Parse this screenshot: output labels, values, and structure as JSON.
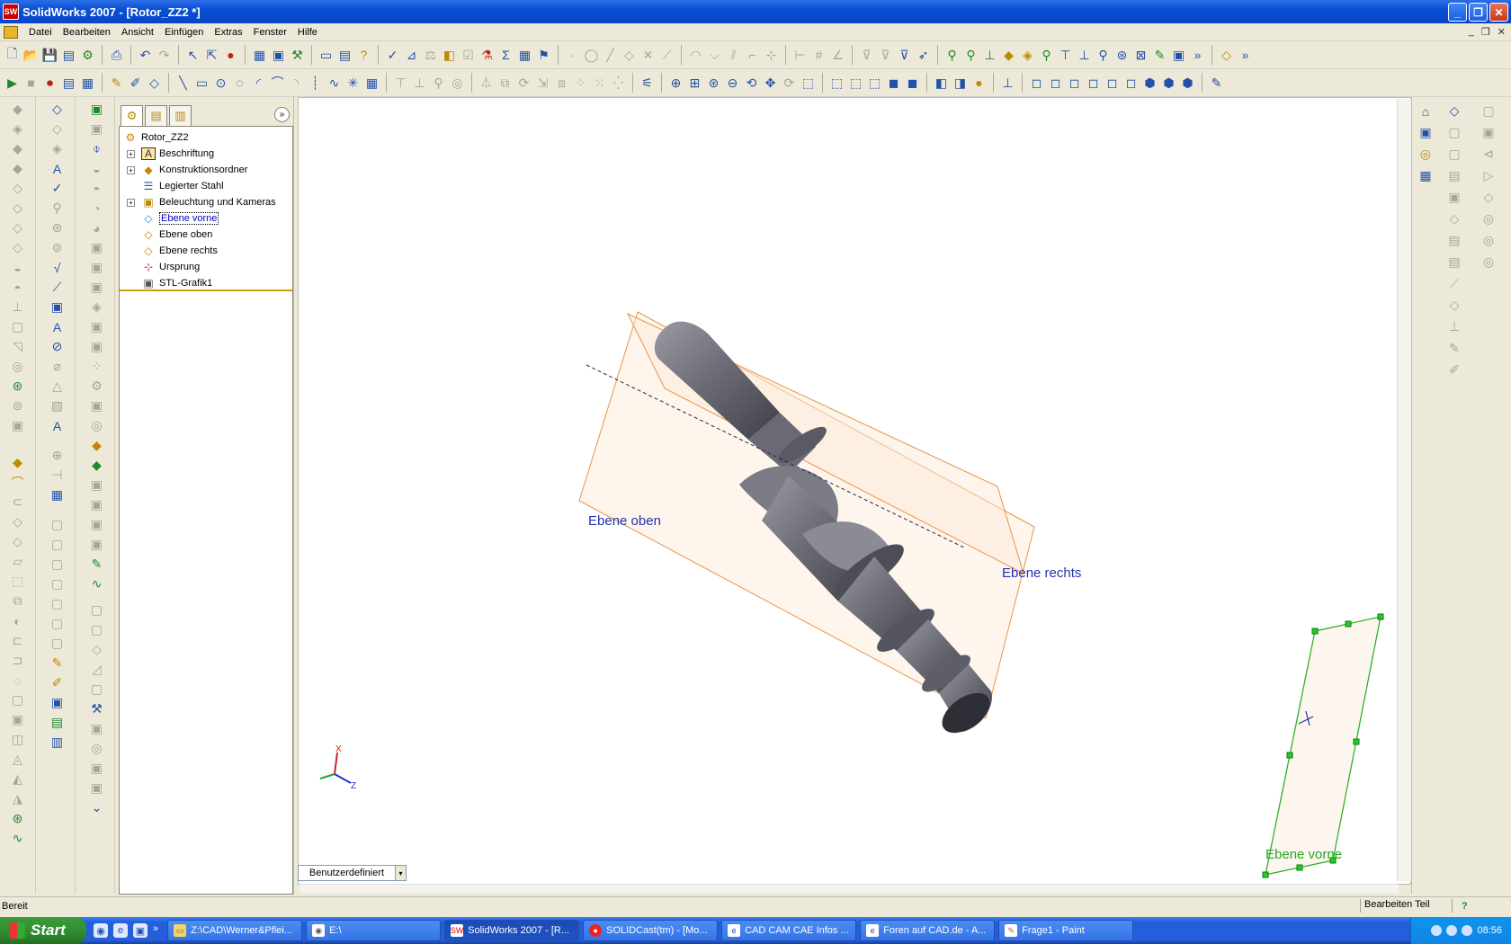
{
  "window": {
    "title": "SolidWorks 2007 - [Rotor_ZZ2 *]",
    "logo_text": "SW",
    "minimize": "_",
    "maximize": "❐",
    "close": "✕"
  },
  "menu": {
    "items": [
      "Datei",
      "Bearbeiten",
      "Ansicht",
      "Einfügen",
      "Extras",
      "Fenster",
      "Hilfe"
    ],
    "doc_controls": [
      "_",
      "❐",
      "✕"
    ]
  },
  "feature_manager": {
    "collapse": "»",
    "root": "Rotor_ZZ2",
    "items": [
      {
        "label": "Beschriftung",
        "icon": "annotations-icon",
        "expandable": true
      },
      {
        "label": "Konstruktionsordner",
        "icon": "design-folder-icon",
        "expandable": true
      },
      {
        "label": "Legierter Stahl",
        "icon": "material-icon",
        "expandable": false
      },
      {
        "label": "Beleuchtung und Kameras",
        "icon": "lights-cameras-icon",
        "expandable": true
      },
      {
        "label": "Ebene vorne",
        "icon": "plane-icon",
        "expandable": false,
        "selected": true
      },
      {
        "label": "Ebene oben",
        "icon": "plane-icon",
        "expandable": false
      },
      {
        "label": "Ebene rechts",
        "icon": "plane-icon",
        "expandable": false
      },
      {
        "label": "Ursprung",
        "icon": "origin-icon",
        "expandable": false
      },
      {
        "label": "STL-Grafik1",
        "icon": "stl-graphic-icon",
        "expandable": false
      }
    ],
    "plus": "+"
  },
  "viewport": {
    "labels": {
      "top_plane": "Ebene oben",
      "right_plane": "Ebene rechts",
      "front_plane": "Ebene vorne"
    },
    "triad": {
      "x": "X",
      "z": "Z"
    },
    "view_combo": "Benutzerdefiniert",
    "view_combo_arrow": "▾"
  },
  "status": {
    "left": "Bereit",
    "mode": "Bearbeiten Teil",
    "help": "?"
  },
  "taskbar": {
    "start": "Start",
    "tasks": [
      {
        "label": "Z:\\CAD\\Werner&Pflei...",
        "icon": "folder-icon"
      },
      {
        "label": "E:\\",
        "icon": "drive-icon"
      },
      {
        "label": "SolidWorks 2007 - [R...",
        "icon": "solidworks-icon",
        "active": true
      },
      {
        "label": "SOLIDCast(tm) - [Mo...",
        "icon": "solidcast-icon"
      },
      {
        "label": "CAD CAM CAE Infos ...",
        "icon": "ie-icon"
      },
      {
        "label": "Foren auf CAD.de - A...",
        "icon": "ie-icon"
      },
      {
        "label": "Frage1 - Paint",
        "icon": "paint-icon"
      }
    ],
    "clock": "08:56",
    "more": "»"
  },
  "colors": {
    "titlebar": "#0a4fd5",
    "plane_outline": "#e8954a",
    "plane_fill": "#fdf1e6",
    "plane_label": "#2233aa",
    "front_plane_outline": "#22aa22",
    "part": "#6f6f78"
  }
}
